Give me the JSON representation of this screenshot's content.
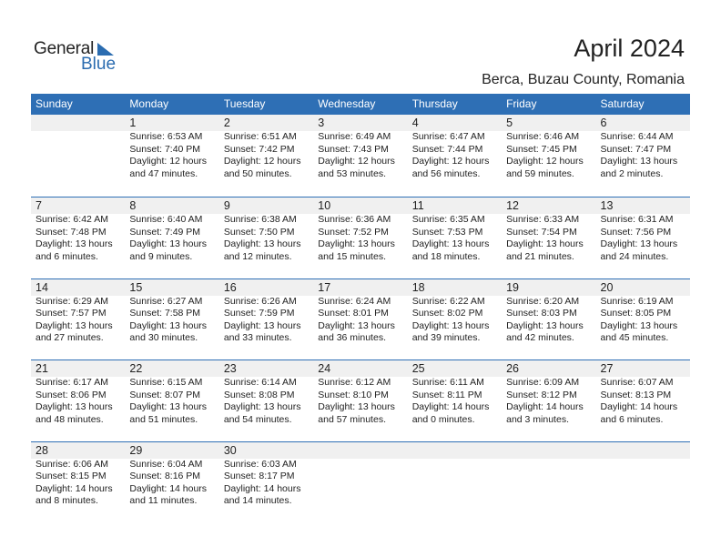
{
  "logo": {
    "word1": "General",
    "word2": "Blue"
  },
  "header": {
    "title": "April 2024",
    "location": "Berca, Buzau County, Romania"
  },
  "colors": {
    "accent": "#2e6fb5",
    "daybar": "#f0f0f0"
  },
  "weekdays": [
    "Sunday",
    "Monday",
    "Tuesday",
    "Wednesday",
    "Thursday",
    "Friday",
    "Saturday"
  ],
  "weeks": [
    [
      null,
      {
        "day": "1",
        "sunrise": "Sunrise: 6:53 AM",
        "sunset": "Sunset: 7:40 PM",
        "daylight1": "Daylight: 12 hours",
        "daylight2": "and 47 minutes."
      },
      {
        "day": "2",
        "sunrise": "Sunrise: 6:51 AM",
        "sunset": "Sunset: 7:42 PM",
        "daylight1": "Daylight: 12 hours",
        "daylight2": "and 50 minutes."
      },
      {
        "day": "3",
        "sunrise": "Sunrise: 6:49 AM",
        "sunset": "Sunset: 7:43 PM",
        "daylight1": "Daylight: 12 hours",
        "daylight2": "and 53 minutes."
      },
      {
        "day": "4",
        "sunrise": "Sunrise: 6:47 AM",
        "sunset": "Sunset: 7:44 PM",
        "daylight1": "Daylight: 12 hours",
        "daylight2": "and 56 minutes."
      },
      {
        "day": "5",
        "sunrise": "Sunrise: 6:46 AM",
        "sunset": "Sunset: 7:45 PM",
        "daylight1": "Daylight: 12 hours",
        "daylight2": "and 59 minutes."
      },
      {
        "day": "6",
        "sunrise": "Sunrise: 6:44 AM",
        "sunset": "Sunset: 7:47 PM",
        "daylight1": "Daylight: 13 hours",
        "daylight2": "and 2 minutes."
      }
    ],
    [
      {
        "day": "7",
        "sunrise": "Sunrise: 6:42 AM",
        "sunset": "Sunset: 7:48 PM",
        "daylight1": "Daylight: 13 hours",
        "daylight2": "and 6 minutes."
      },
      {
        "day": "8",
        "sunrise": "Sunrise: 6:40 AM",
        "sunset": "Sunset: 7:49 PM",
        "daylight1": "Daylight: 13 hours",
        "daylight2": "and 9 minutes."
      },
      {
        "day": "9",
        "sunrise": "Sunrise: 6:38 AM",
        "sunset": "Sunset: 7:50 PM",
        "daylight1": "Daylight: 13 hours",
        "daylight2": "and 12 minutes."
      },
      {
        "day": "10",
        "sunrise": "Sunrise: 6:36 AM",
        "sunset": "Sunset: 7:52 PM",
        "daylight1": "Daylight: 13 hours",
        "daylight2": "and 15 minutes."
      },
      {
        "day": "11",
        "sunrise": "Sunrise: 6:35 AM",
        "sunset": "Sunset: 7:53 PM",
        "daylight1": "Daylight: 13 hours",
        "daylight2": "and 18 minutes."
      },
      {
        "day": "12",
        "sunrise": "Sunrise: 6:33 AM",
        "sunset": "Sunset: 7:54 PM",
        "daylight1": "Daylight: 13 hours",
        "daylight2": "and 21 minutes."
      },
      {
        "day": "13",
        "sunrise": "Sunrise: 6:31 AM",
        "sunset": "Sunset: 7:56 PM",
        "daylight1": "Daylight: 13 hours",
        "daylight2": "and 24 minutes."
      }
    ],
    [
      {
        "day": "14",
        "sunrise": "Sunrise: 6:29 AM",
        "sunset": "Sunset: 7:57 PM",
        "daylight1": "Daylight: 13 hours",
        "daylight2": "and 27 minutes."
      },
      {
        "day": "15",
        "sunrise": "Sunrise: 6:27 AM",
        "sunset": "Sunset: 7:58 PM",
        "daylight1": "Daylight: 13 hours",
        "daylight2": "and 30 minutes."
      },
      {
        "day": "16",
        "sunrise": "Sunrise: 6:26 AM",
        "sunset": "Sunset: 7:59 PM",
        "daylight1": "Daylight: 13 hours",
        "daylight2": "and 33 minutes."
      },
      {
        "day": "17",
        "sunrise": "Sunrise: 6:24 AM",
        "sunset": "Sunset: 8:01 PM",
        "daylight1": "Daylight: 13 hours",
        "daylight2": "and 36 minutes."
      },
      {
        "day": "18",
        "sunrise": "Sunrise: 6:22 AM",
        "sunset": "Sunset: 8:02 PM",
        "daylight1": "Daylight: 13 hours",
        "daylight2": "and 39 minutes."
      },
      {
        "day": "19",
        "sunrise": "Sunrise: 6:20 AM",
        "sunset": "Sunset: 8:03 PM",
        "daylight1": "Daylight: 13 hours",
        "daylight2": "and 42 minutes."
      },
      {
        "day": "20",
        "sunrise": "Sunrise: 6:19 AM",
        "sunset": "Sunset: 8:05 PM",
        "daylight1": "Daylight: 13 hours",
        "daylight2": "and 45 minutes."
      }
    ],
    [
      {
        "day": "21",
        "sunrise": "Sunrise: 6:17 AM",
        "sunset": "Sunset: 8:06 PM",
        "daylight1": "Daylight: 13 hours",
        "daylight2": "and 48 minutes."
      },
      {
        "day": "22",
        "sunrise": "Sunrise: 6:15 AM",
        "sunset": "Sunset: 8:07 PM",
        "daylight1": "Daylight: 13 hours",
        "daylight2": "and 51 minutes."
      },
      {
        "day": "23",
        "sunrise": "Sunrise: 6:14 AM",
        "sunset": "Sunset: 8:08 PM",
        "daylight1": "Daylight: 13 hours",
        "daylight2": "and 54 minutes."
      },
      {
        "day": "24",
        "sunrise": "Sunrise: 6:12 AM",
        "sunset": "Sunset: 8:10 PM",
        "daylight1": "Daylight: 13 hours",
        "daylight2": "and 57 minutes."
      },
      {
        "day": "25",
        "sunrise": "Sunrise: 6:11 AM",
        "sunset": "Sunset: 8:11 PM",
        "daylight1": "Daylight: 14 hours",
        "daylight2": "and 0 minutes."
      },
      {
        "day": "26",
        "sunrise": "Sunrise: 6:09 AM",
        "sunset": "Sunset: 8:12 PM",
        "daylight1": "Daylight: 14 hours",
        "daylight2": "and 3 minutes."
      },
      {
        "day": "27",
        "sunrise": "Sunrise: 6:07 AM",
        "sunset": "Sunset: 8:13 PM",
        "daylight1": "Daylight: 14 hours",
        "daylight2": "and 6 minutes."
      }
    ],
    [
      {
        "day": "28",
        "sunrise": "Sunrise: 6:06 AM",
        "sunset": "Sunset: 8:15 PM",
        "daylight1": "Daylight: 14 hours",
        "daylight2": "and 8 minutes."
      },
      {
        "day": "29",
        "sunrise": "Sunrise: 6:04 AM",
        "sunset": "Sunset: 8:16 PM",
        "daylight1": "Daylight: 14 hours",
        "daylight2": "and 11 minutes."
      },
      {
        "day": "30",
        "sunrise": "Sunrise: 6:03 AM",
        "sunset": "Sunset: 8:17 PM",
        "daylight1": "Daylight: 14 hours",
        "daylight2": "and 14 minutes."
      },
      null,
      null,
      null,
      null
    ]
  ]
}
